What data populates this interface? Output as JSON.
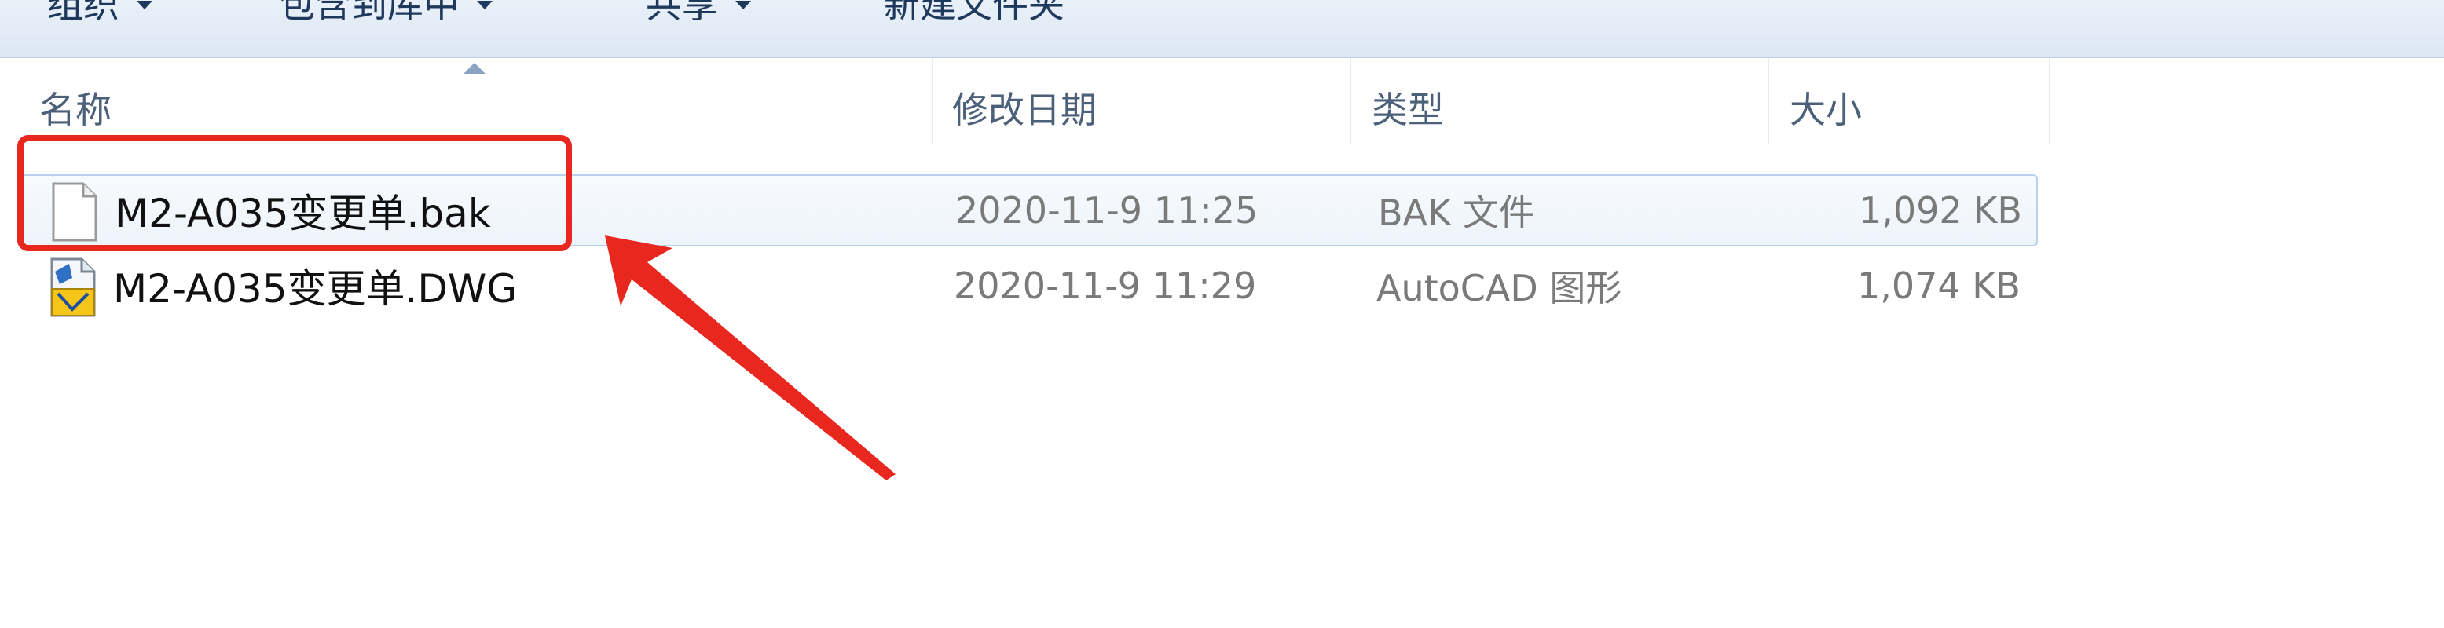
{
  "toolbar": {
    "items": [
      {
        "label": "组织",
        "has_dropdown": true
      },
      {
        "label": "包含到库中",
        "has_dropdown": true
      },
      {
        "label": "共享",
        "has_dropdown": true
      },
      {
        "label": "新建文件夹",
        "has_dropdown": false
      }
    ]
  },
  "columns": {
    "name": "名称",
    "date": "修改日期",
    "type": "类型",
    "size": "大小"
  },
  "files": [
    {
      "name": "M2-A035变更单.bak",
      "date": "2020-11-9 11:25",
      "type": "BAK 文件",
      "size": "1,092 KB",
      "icon": "blank-file-icon",
      "selected": true
    },
    {
      "name": "M2-A035变更单.DWG",
      "date": "2020-11-9 11:29",
      "type": "AutoCAD 图形",
      "size": "1,074 KB",
      "icon": "dwg-file-icon",
      "selected": false
    }
  ],
  "colors": {
    "annotation": "#e8271f",
    "selection_border": "#b9d1ef",
    "header_text": "#4c607a"
  }
}
